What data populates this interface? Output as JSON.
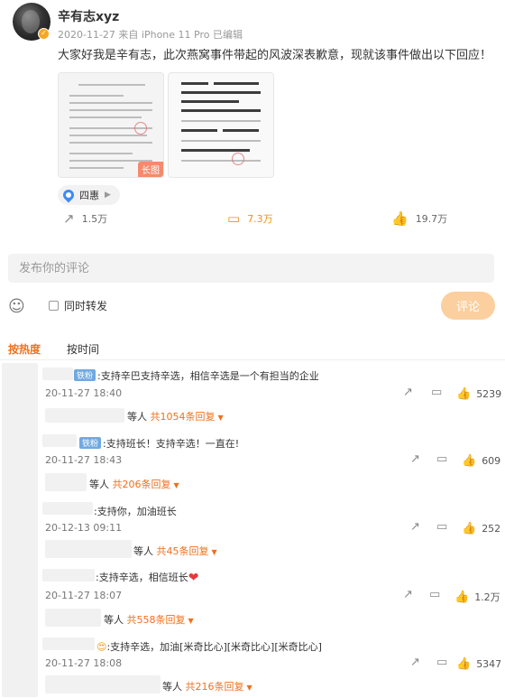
{
  "post": {
    "username": "辛有志xyz",
    "meta": "2020-11-27  来自 iPhone 11 Pro 已编辑",
    "text": "大家好我是辛有志，此次燕窝事件带起的风波深表歉意，现就该事件做出以下回应！",
    "image_badge": "长图",
    "location": "四惠",
    "reposts": "1.5万",
    "comments": "7.3万",
    "likes": "19.7万"
  },
  "compose": {
    "placeholder": "发布你的评论",
    "repost_label": "同时转发",
    "submit_label": "评论"
  },
  "sort": {
    "hot": "按热度",
    "time": "按时间"
  },
  "comments": [
    {
      "badge": "铁粉",
      "text": ":支持辛巴支持辛选，相信辛选是一个有担当的企业",
      "time": "20-11-27 18:40",
      "likes": "5239",
      "reply_prefix": "等人 ",
      "reply_count": "共1054条回复"
    },
    {
      "badge": "铁粉",
      "text": ":支持班长！支持辛选！一直在!",
      "time": "20-11-27 18:43",
      "likes": "609",
      "reply_prefix": "等人 ",
      "reply_count": "共206条回复"
    },
    {
      "badge": "",
      "text": ":支持你，加油班长",
      "time": "20-12-13 09:11",
      "likes": "252",
      "reply_prefix": "等人 ",
      "reply_count": "共45条回复"
    },
    {
      "badge": "",
      "text": ":支持辛选，相信班长",
      "time": "20-11-27 18:07",
      "likes": "1.2万",
      "reply_prefix": "等人 ",
      "reply_count": "共558条回复"
    },
    {
      "badge": "",
      "text": ":支持辛选，加油[米奇比心][米奇比心][米奇比心]",
      "time": "20-11-27 18:08",
      "likes": "5347",
      "reply_prefix": "等人 ",
      "reply_count": "共216条回复"
    }
  ]
}
